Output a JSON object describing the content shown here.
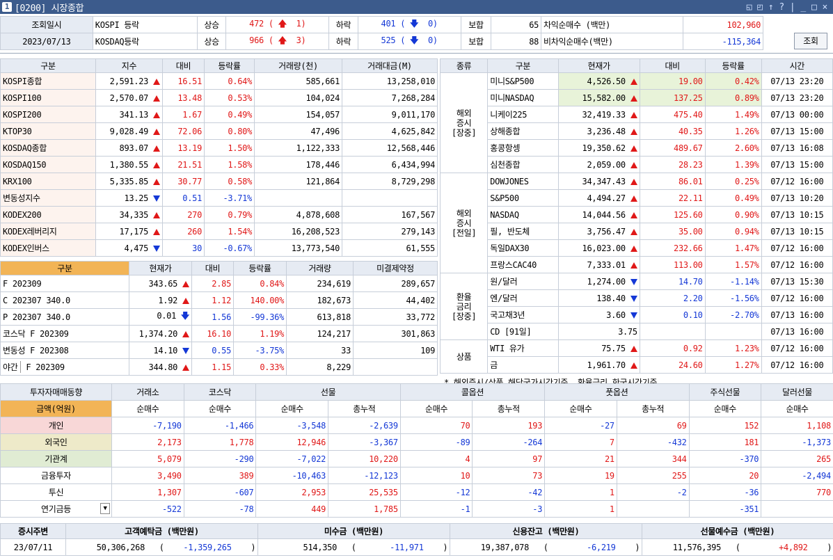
{
  "window": {
    "number": "1",
    "title": "[0200] 시장종합",
    "controls": [
      "◱",
      "◰",
      "↑",
      "?",
      "|",
      "_",
      "□",
      "×"
    ]
  },
  "summary": {
    "date_label": "조회일시",
    "date_value": "2023/07/13",
    "rows": [
      {
        "market": "KOSPI 등락",
        "up_label": "상승",
        "up": "472",
        "up_limit": "1",
        "down_label": "하락",
        "down": "401",
        "down_limit": "0",
        "flat_label": "보합",
        "flat": "65",
        "arb_label": "차익순매수  (백만)",
        "arb_value": "102,960"
      },
      {
        "market": "KOSDAQ등락",
        "up_label": "상승",
        "up": "966",
        "up_limit": "3",
        "down_label": "하락",
        "down": "525",
        "down_limit": "0",
        "flat_label": "보합",
        "flat": "88",
        "arb_label": "비차익순매수(백만)",
        "arb_value": "-115,364"
      }
    ],
    "query_button": "조회"
  },
  "index_table": {
    "headers": [
      "구분",
      "지수",
      "대비",
      "등락률",
      "거래량(천)",
      "거래대금(M)"
    ],
    "rows": [
      {
        "name": "KOSPI종합",
        "value": "2,591.23",
        "dir": "up",
        "chg": "16.51",
        "rate": "0.64%",
        "vol": "585,661",
        "amt": "13,258,010"
      },
      {
        "name": "KOSPI100",
        "value": "2,570.07",
        "dir": "up",
        "chg": "13.48",
        "rate": "0.53%",
        "vol": "104,024",
        "amt": "7,268,284"
      },
      {
        "name": "KOSPI200",
        "value": "341.13",
        "dir": "up",
        "chg": "1.67",
        "rate": "0.49%",
        "vol": "154,057",
        "amt": "9,011,170"
      },
      {
        "name": "KTOP30",
        "value": "9,028.49",
        "dir": "up",
        "chg": "72.06",
        "rate": "0.80%",
        "vol": "47,496",
        "amt": "4,625,842"
      },
      {
        "name": "KOSDAQ종합",
        "value": "893.07",
        "dir": "up",
        "chg": "13.19",
        "rate": "1.50%",
        "vol": "1,122,333",
        "amt": "12,568,446"
      },
      {
        "name": "KOSDAQ150",
        "value": "1,380.55",
        "dir": "up",
        "chg": "21.51",
        "rate": "1.58%",
        "vol": "178,446",
        "amt": "6,434,994"
      },
      {
        "name": "KRX100",
        "value": "5,335.85",
        "dir": "up",
        "chg": "30.77",
        "rate": "0.58%",
        "vol": "121,864",
        "amt": "8,729,298"
      },
      {
        "name": "변동성지수",
        "value": "13.25",
        "dir": "down",
        "chg": "0.51",
        "rate": "-3.71%",
        "vol": "",
        "amt": ""
      },
      {
        "name": "KODEX200",
        "value": "34,335",
        "dir": "up",
        "chg": "270",
        "rate": "0.79%",
        "vol": "4,878,608",
        "amt": "167,567"
      },
      {
        "name": "KODEX레버리지",
        "value": "17,175",
        "dir": "up",
        "chg": "260",
        "rate": "1.54%",
        "vol": "16,208,523",
        "amt": "279,143"
      },
      {
        "name": "KODEX인버스",
        "value": "4,475",
        "dir": "down",
        "chg": "30",
        "rate": "-0.67%",
        "vol": "13,773,540",
        "amt": "61,555"
      }
    ]
  },
  "futures_table": {
    "headers": [
      "구분",
      "현재가",
      "대비",
      "등락률",
      "거래량",
      "미결제약정"
    ],
    "rows": [
      {
        "name": "F 202309",
        "value": "343.65",
        "dir": "up",
        "chg": "2.85",
        "rate": "0.84%",
        "vol": "234,619",
        "oi": "289,657"
      },
      {
        "name": "C 202307 340.0",
        "value": "1.92",
        "dir": "up",
        "chg": "1.12",
        "rate": "140.00%",
        "vol": "182,673",
        "oi": "44,402"
      },
      {
        "name": "P 202307 340.0",
        "value": "0.01",
        "dir": "downarrow",
        "chg": "1.56",
        "rate": "-99.36%",
        "vol": "613,818",
        "oi": "33,772"
      },
      {
        "name": "코스닥 F 202309",
        "value": "1,374.20",
        "dir": "up",
        "chg": "16.10",
        "rate": "1.19%",
        "vol": "124,217",
        "oi": "301,863"
      },
      {
        "name": "변동성 F 202308",
        "value": "14.10",
        "dir": "down",
        "chg": "0.55",
        "rate": "-3.75%",
        "vol": "33",
        "oi": "109"
      },
      {
        "name_a": "야간",
        "name": "F 202309",
        "value": "344.80",
        "dir": "up",
        "chg": "1.15",
        "rate": "0.33%",
        "vol": "8,229",
        "oi": ""
      }
    ]
  },
  "global_table": {
    "headers": [
      "종류",
      "구분",
      "현재가",
      "대비",
      "등락률",
      "시간"
    ],
    "groups": [
      {
        "label": "해외\n증시\n[장중]",
        "rows": [
          {
            "name": "미니S&P500",
            "value": "4,526.50",
            "dir": "up",
            "chg": "19.00",
            "rate": "0.42%",
            "time": "07/13 23:20"
          },
          {
            "name": "미니NASDAQ",
            "value": "15,582.00",
            "dir": "up",
            "chg": "137.25",
            "rate": "0.89%",
            "time": "07/13 23:20"
          },
          {
            "name": "니케이225",
            "value": "32,419.33",
            "dir": "up",
            "chg": "475.40",
            "rate": "1.49%",
            "time": "07/13 00:00"
          },
          {
            "name": "상해종합",
            "value": "3,236.48",
            "dir": "up",
            "chg": "40.35",
            "rate": "1.26%",
            "time": "07/13 15:00"
          },
          {
            "name": "홍콩항셍",
            "value": "19,350.62",
            "dir": "up",
            "chg": "489.67",
            "rate": "2.60%",
            "time": "07/13 16:08"
          },
          {
            "name": "심천종합",
            "value": "2,059.00",
            "dir": "up",
            "chg": "28.23",
            "rate": "1.39%",
            "time": "07/13 15:00"
          }
        ]
      },
      {
        "label": "해외\n증시\n[전일]",
        "rows": [
          {
            "name": "DOWJONES",
            "value": "34,347.43",
            "dir": "up",
            "chg": "86.01",
            "rate": "0.25%",
            "time": "07/12 16:00"
          },
          {
            "name": "S&P500",
            "value": "4,494.27",
            "dir": "up",
            "chg": "22.11",
            "rate": "0.49%",
            "time": "07/13 10:20"
          },
          {
            "name": "NASDAQ",
            "value": "14,044.56",
            "dir": "up",
            "chg": "125.60",
            "rate": "0.90%",
            "time": "07/13 10:15"
          },
          {
            "name": "필, 반도체",
            "value": "3,756.47",
            "dir": "up",
            "chg": "35.00",
            "rate": "0.94%",
            "time": "07/13 10:15"
          },
          {
            "name": "독일DAX30",
            "value": "16,023.00",
            "dir": "up",
            "chg": "232.66",
            "rate": "1.47%",
            "time": "07/12 16:00"
          },
          {
            "name": "프랑스CAC40",
            "value": "7,333.01",
            "dir": "up",
            "chg": "113.00",
            "rate": "1.57%",
            "time": "07/12 16:00"
          }
        ]
      },
      {
        "label": "환율\n금리\n[장중]",
        "rows": [
          {
            "name": "원/달러",
            "value": "1,274.00",
            "dir": "down",
            "chg": "14.70",
            "rate": "-1.14%",
            "time": "07/13 15:30"
          },
          {
            "name": "엔/달러",
            "value": "138.40",
            "dir": "down",
            "chg": "2.20",
            "rate": "-1.56%",
            "time": "07/12 16:00"
          },
          {
            "name": "국고채3년",
            "value": "3.60",
            "dir": "down",
            "chg": "0.10",
            "rate": "-2.70%",
            "time": "07/13 16:00"
          },
          {
            "name": "CD [91일]",
            "value": "3.75",
            "dir": "",
            "chg": "",
            "rate": "",
            "time": "07/13 16:00"
          }
        ]
      },
      {
        "label": "상품",
        "rows": [
          {
            "name": "WTI 유가",
            "value": "75.75",
            "dir": "up",
            "chg": "0.92",
            "rate": "1.23%",
            "time": "07/12 16:00"
          },
          {
            "name": "금",
            "value": "1,961.70",
            "dir": "up",
            "chg": "24.60",
            "rate": "1.27%",
            "time": "07/12 16:00"
          }
        ]
      }
    ],
    "note": "* 해외증시/상품 해당국가시간기준, 환율금리 한국시간기준"
  },
  "investor_table": {
    "title": "투자자매매동향",
    "unit": "금액(억원)",
    "groups": [
      "거래소",
      "코스닥",
      "선물",
      "콜옵션",
      "풋옵션",
      "주식선물",
      "달러선물"
    ],
    "subheads": [
      "순매수",
      "순매수",
      "순매수",
      "총누적",
      "순매수",
      "총누적",
      "순매수",
      "총누적",
      "순매수",
      "순매수"
    ],
    "rows": [
      {
        "name": "개인",
        "vals": [
          "-7,190",
          "-1,466",
          "-3,548",
          "-2,639",
          "70",
          "193",
          "-27",
          "69",
          "152",
          "1,108"
        ]
      },
      {
        "name": "외국인",
        "vals": [
          "2,173",
          "1,778",
          "12,946",
          "-3,367",
          "-89",
          "-264",
          "7",
          "-432",
          "181",
          "-1,373"
        ]
      },
      {
        "name": "기관계",
        "vals": [
          "5,079",
          "-290",
          "-7,022",
          "10,220",
          "4",
          "97",
          "21",
          "344",
          "-370",
          "265"
        ]
      },
      {
        "name": "금융투자",
        "vals": [
          "3,490",
          "389",
          "-10,463",
          "-12,123",
          "10",
          "73",
          "19",
          "255",
          "20",
          "-2,494"
        ]
      },
      {
        "name": "투신",
        "vals": [
          "1,307",
          "-607",
          "2,953",
          "25,535",
          "-12",
          "-42",
          "1",
          "-2",
          "-36",
          "770"
        ]
      },
      {
        "name": "연기금등",
        "vals": [
          "-522",
          "-78",
          "449",
          "1,785",
          "-1",
          "-3",
          "1",
          "",
          "-351",
          ""
        ]
      }
    ]
  },
  "deposit_table": {
    "headers": [
      "증시주변",
      "고객예탁금 (백만원)",
      "미수금 (백만원)",
      "신용잔고 (백만원)",
      "선물예수금 (백만원)"
    ],
    "date": "23/07/11",
    "items": [
      {
        "value": "50,306,268",
        "chg": "-1,359,265"
      },
      {
        "value": "514,350",
        "chg": "-11,971"
      },
      {
        "value": "19,387,078",
        "chg": "-6,219"
      },
      {
        "value": "11,576,395",
        "chg": "+4,892"
      }
    ]
  }
}
